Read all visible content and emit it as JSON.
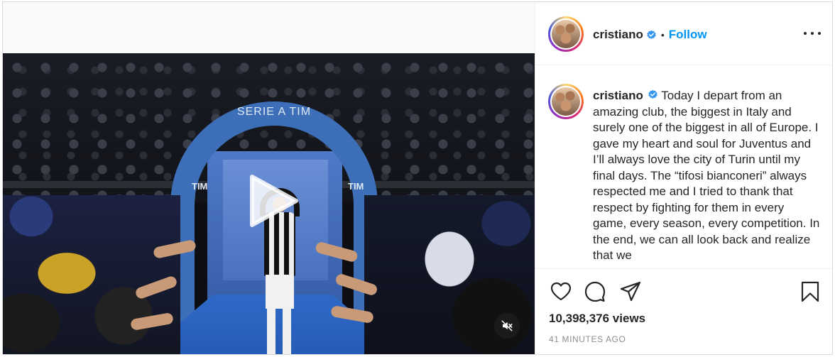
{
  "post": {
    "username": "cristiano",
    "follow_label": "Follow",
    "dot": "•",
    "caption": "Today I depart from an amazing club, the biggest in Italy and surely one of the biggest in all of Europe. I gave my heart and soul for Juventus and I’ll always love the city of Turin until my final days. The “tifosi bianconeri” always respected me and I tried to thank that respect by fighting for them in every game, every season, every competition. In the end, we can all look back and realize that we",
    "views": "10,398,376 views",
    "timestamp": "41 MINUTES AGO"
  },
  "video": {
    "arch_text": "SERIE A TIM",
    "sponsor_left": "TIM",
    "sponsor_right": "TIM",
    "state": "paused",
    "muted": true
  },
  "icons": {
    "header_avatar": "profile-avatar",
    "verified": "verified-badge-icon",
    "more": "more-options-icon",
    "like": "heart-icon",
    "comment": "comment-icon",
    "share": "share-icon",
    "save": "bookmark-icon",
    "play": "play-icon",
    "mute": "muted-speaker-icon"
  },
  "colors": {
    "accent": "#0095f6",
    "text": "#262626",
    "muted_text": "#8e8e8e",
    "border": "#dbdbdb"
  }
}
